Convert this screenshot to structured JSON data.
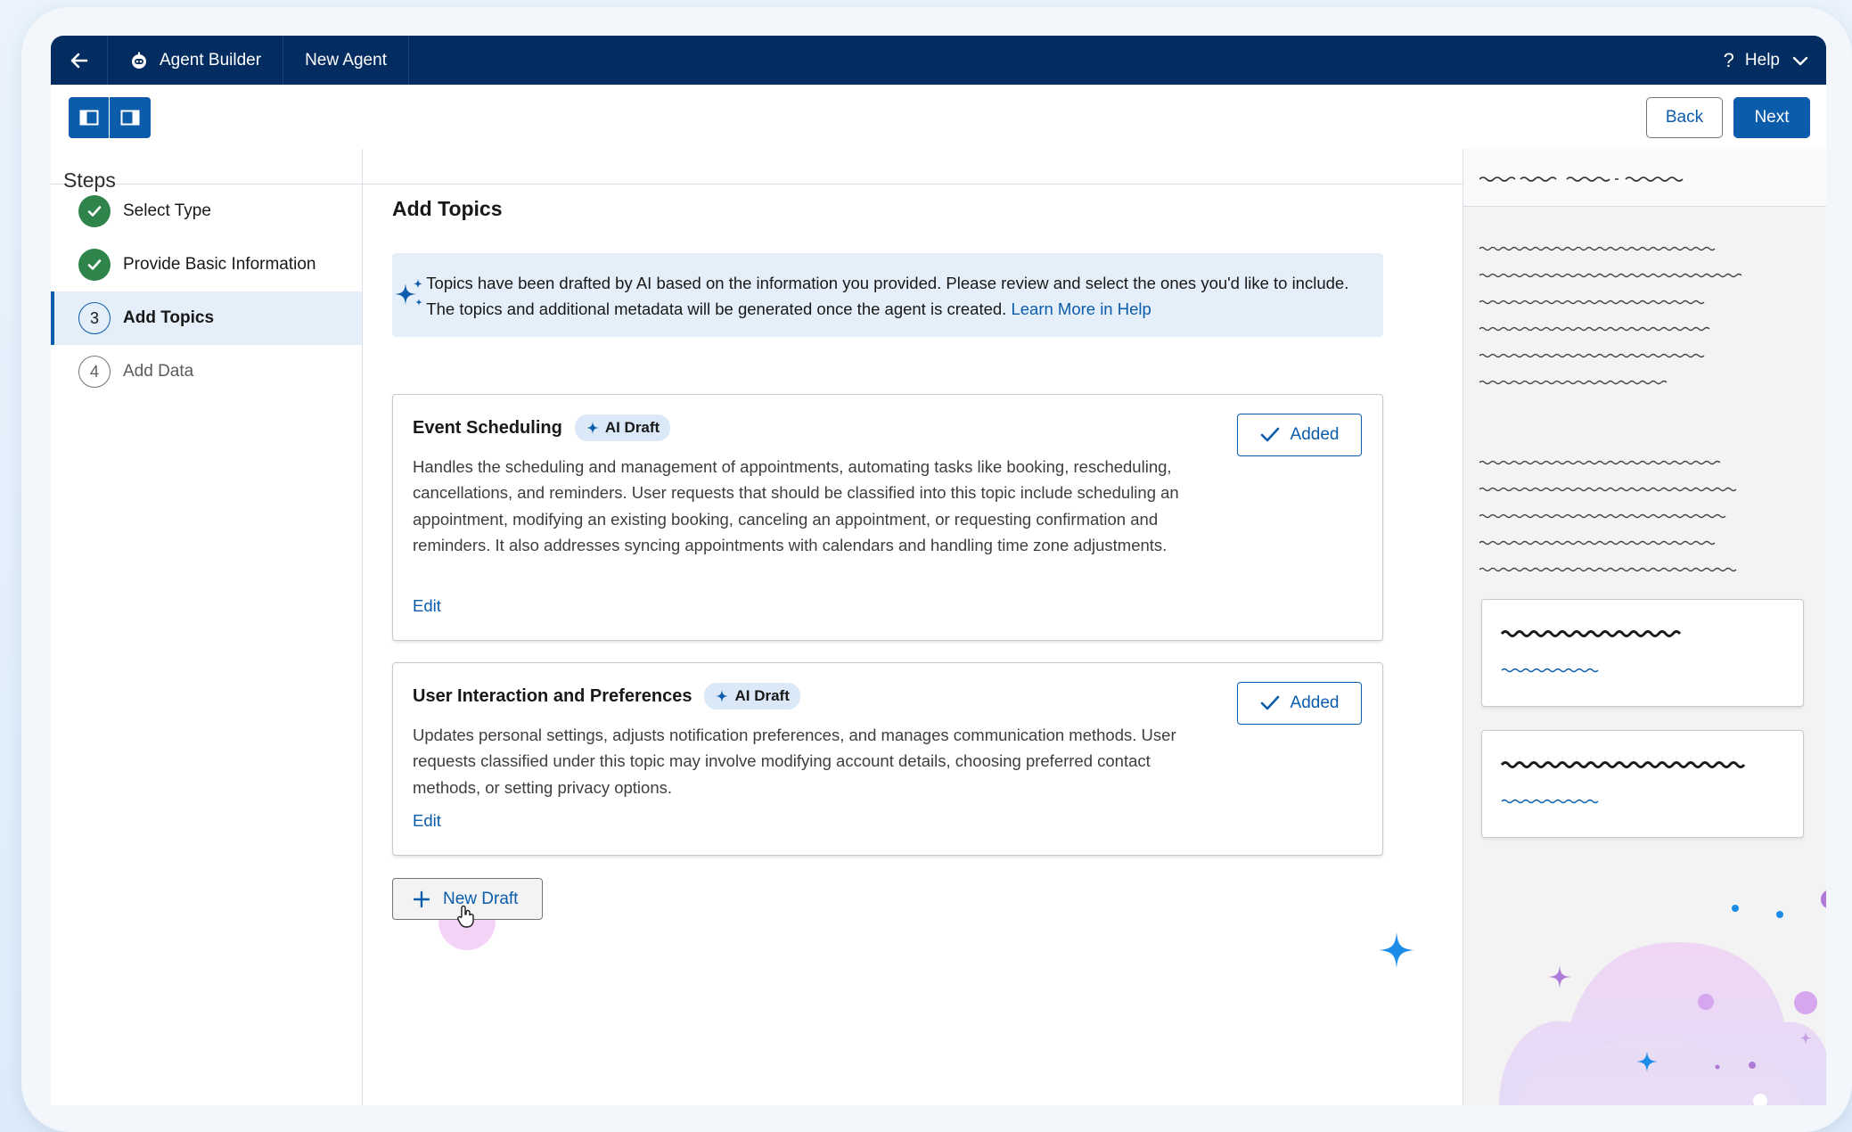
{
  "nav": {
    "app_name": "Agent Builder",
    "page_name": "New Agent",
    "help_label": "Help"
  },
  "toolbar": {
    "back_label": "Back",
    "next_label": "Next"
  },
  "sidebar": {
    "title": "Steps",
    "steps": [
      {
        "label": "Select Type",
        "state": "complete"
      },
      {
        "label": "Provide Basic Information",
        "state": "complete"
      },
      {
        "number": "3",
        "label": "Add Topics",
        "state": "active"
      },
      {
        "number": "4",
        "label": "Add Data",
        "state": "todo"
      }
    ]
  },
  "main": {
    "title": "Add Topics",
    "info": {
      "text": "Topics have been drafted by AI based on the information you provided. Please review and select the ones you'd like to include. The topics and additional metadata will be generated once the agent is created.",
      "link": "Learn More in Help"
    },
    "topics": [
      {
        "title": "Event Scheduling",
        "badge": "AI Draft",
        "description": "Handles the scheduling and management of appointments, automating tasks like booking, rescheduling, cancellations, and reminders. User requests that should be classified into this topic include scheduling an appointment, modifying an existing booking, canceling an appointment, or requesting confirmation and reminders. It also addresses syncing appointments with calendars and handling time zone adjustments.",
        "edit_label": "Edit",
        "status_label": "Added"
      },
      {
        "title": "User Interaction and Preferences",
        "badge": "AI Draft",
        "description": "Updates personal settings, adjusts notification preferences, and manages communication methods. User requests classified under this topic may involve modifying account details, choosing preferred contact methods, or setting privacy options.",
        "edit_label": "Edit",
        "status_label": "Added"
      }
    ],
    "new_draft_label": "New Draft"
  },
  "colors": {
    "nav_bg": "#032d60",
    "brand_blue": "#0b5cab",
    "success_green": "#2e844a",
    "info_bg": "#e5eff9"
  },
  "icons": [
    "back-arrow-icon",
    "agent-bot-icon",
    "question-icon",
    "chevron-down-icon",
    "left-panel-icon",
    "right-panel-icon",
    "check-icon",
    "sparkle-icon",
    "plus-icon",
    "hand-cursor-icon"
  ]
}
